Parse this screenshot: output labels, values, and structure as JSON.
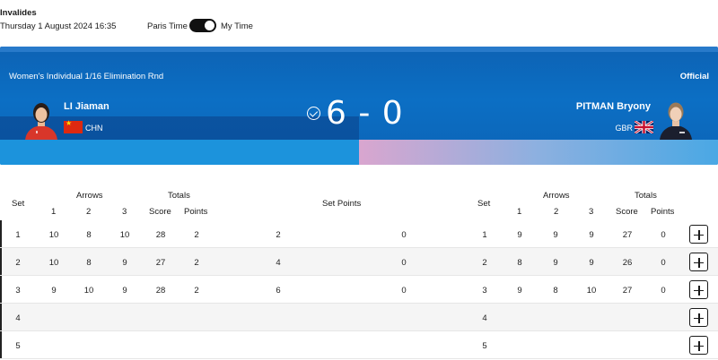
{
  "header": {
    "venue": "Invalides",
    "datetime": "Thursday 1 August 2024 16:35",
    "tz_paris": "Paris Time",
    "tz_my": "My Time",
    "toggle_state": "my-time"
  },
  "match": {
    "round": "Women's Individual 1/16 Elimination Rnd",
    "status": "Official",
    "score": "6 - 0",
    "left": {
      "name": "LI Jiaman",
      "noc": "CHN",
      "flag": "china-flag"
    },
    "right": {
      "name": "PITMAN Bryony",
      "noc": "GBR",
      "flag": "uk-flag"
    }
  },
  "table": {
    "headers": {
      "set": "Set",
      "arrows": "Arrows",
      "totals": "Totals",
      "a1": "1",
      "a2": "2",
      "a3": "3",
      "score": "Score",
      "points": "Points",
      "set_points": "Set Points"
    },
    "rows": [
      {
        "set": "1",
        "l": [
          "10",
          "8",
          "10"
        ],
        "l_score": "28",
        "l_points": "2",
        "sp_left": "2",
        "sp_right": "0",
        "r": [
          "9",
          "9",
          "9"
        ],
        "r_score": "27",
        "r_points": "0"
      },
      {
        "set": "2",
        "l": [
          "10",
          "8",
          "9"
        ],
        "l_score": "27",
        "l_points": "2",
        "sp_left": "4",
        "sp_right": "0",
        "r": [
          "8",
          "9",
          "9"
        ],
        "r_score": "26",
        "r_points": "0"
      },
      {
        "set": "3",
        "l": [
          "9",
          "10",
          "9"
        ],
        "l_score": "28",
        "l_points": "2",
        "sp_left": "6",
        "sp_right": "0",
        "r": [
          "9",
          "8",
          "10"
        ],
        "r_score": "27",
        "r_points": "0"
      },
      {
        "set": "4",
        "l": [
          "",
          "",
          ""
        ],
        "l_score": "",
        "l_points": "",
        "sp_left": "",
        "sp_right": "",
        "r": [
          "",
          "",
          ""
        ],
        "r_score": "",
        "r_points": ""
      },
      {
        "set": "5",
        "l": [
          "",
          "",
          ""
        ],
        "l_score": "",
        "l_points": "",
        "sp_left": "",
        "sp_right": "",
        "r": [
          "",
          "",
          ""
        ],
        "r_score": "",
        "r_points": ""
      }
    ],
    "expand_icon": "plus-icon"
  }
}
